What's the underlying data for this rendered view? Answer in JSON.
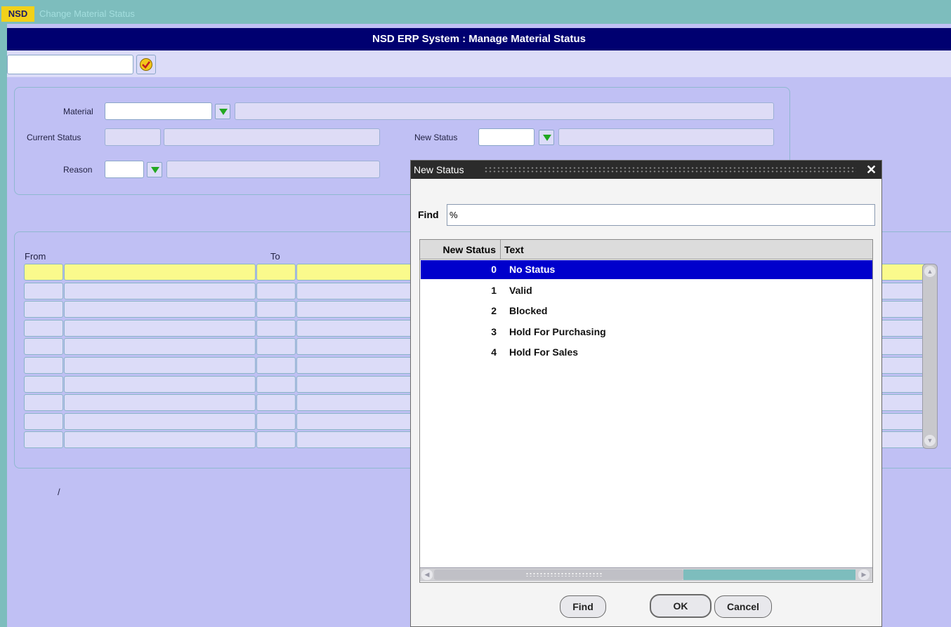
{
  "window": {
    "logo": "NSD",
    "title": "Change Material  Status"
  },
  "header": {
    "title": "NSD ERP System : Manage Material Status"
  },
  "toolbar": {
    "accept_icon": "checkmark-icon"
  },
  "form": {
    "material_label": "Material",
    "current_status_label": "Current Status",
    "new_status_label": "New Status",
    "reason_label": "Reason"
  },
  "grid": {
    "col_from": "From",
    "col_to": "To",
    "row_count": 10,
    "status_text": "/"
  },
  "dialog": {
    "title": "New Status",
    "find_label": "Find",
    "find_value": "%",
    "columns": [
      "New Status",
      "Text"
    ],
    "rows": [
      {
        "code": "0",
        "text": "No Status",
        "selected": true
      },
      {
        "code": "1",
        "text": "Valid"
      },
      {
        "code": "2",
        "text": "Blocked"
      },
      {
        "code": "3",
        "text": "Hold For Purchasing"
      },
      {
        "code": "4",
        "text": "Hold For Sales"
      }
    ],
    "buttons": {
      "find": "Find",
      "ok": "OK",
      "cancel": "Cancel"
    }
  },
  "colors": {
    "header_bg": "#000070",
    "selection": "#0000cc",
    "grid_current_row": "#fafa8c"
  }
}
